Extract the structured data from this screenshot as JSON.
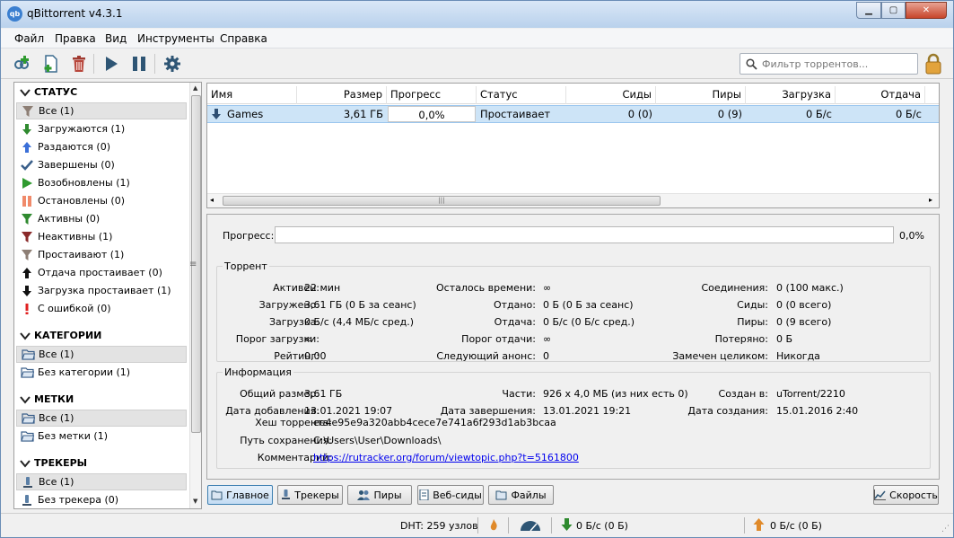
{
  "window": {
    "app_icon_text": "qb",
    "title": "qBittorrent v4.3.1",
    "min_symbol": "▁",
    "max_symbol": "▢",
    "close_symbol": "✕"
  },
  "menu": [
    "Файл",
    "Правка",
    "Вид",
    "Инструменты",
    "Справка"
  ],
  "toolbar": {
    "search_placeholder": "Фильтр торрентов..."
  },
  "sidebar": {
    "status": {
      "title": "СТАТУС",
      "items": [
        {
          "label": "Все (1)",
          "icon": "funnel-icon",
          "color": "#8d7e74"
        },
        {
          "label": "Загружаются (1)",
          "icon": "arrow-down-icon",
          "color": "#2f8a2f"
        },
        {
          "label": "Раздаются (0)",
          "icon": "arrow-up-icon",
          "color": "#3a6fd8"
        },
        {
          "label": "Завершены (0)",
          "icon": "check-icon",
          "color": "#3a5f8a"
        },
        {
          "label": "Возобновлены (1)",
          "icon": "play-icon",
          "color": "#2f9a2f"
        },
        {
          "label": "Остановлены (0)",
          "icon": "pause-icon",
          "color": "#f08a6a"
        },
        {
          "label": "Активны (0)",
          "icon": "funnel-icon",
          "color": "#2f8a2f"
        },
        {
          "label": "Неактивны (1)",
          "icon": "funnel-icon",
          "color": "#8a2a2a"
        },
        {
          "label": "Простаивают (1)",
          "icon": "funnel-icon",
          "color": "#8d7e74"
        },
        {
          "label": "Отдача простаивает (0)",
          "icon": "arrow-up-icon",
          "color": "#111111"
        },
        {
          "label": "Загрузка простаивает (1)",
          "icon": "arrow-down-icon",
          "color": "#111111"
        },
        {
          "label": "С ошибкой (0)",
          "icon": "exclamation-icon",
          "color": "#e02020"
        }
      ]
    },
    "categories": {
      "title": "КАТЕГОРИИ",
      "items": [
        "Все (1)",
        "Без категории (1)"
      ]
    },
    "tags": {
      "title": "МЕТКИ",
      "items": [
        "Все (1)",
        "Без метки (1)"
      ]
    },
    "trackers": {
      "title": "ТРЕКЕРЫ",
      "items": [
        "Все (1)",
        "Без трекера (0)"
      ]
    }
  },
  "table": {
    "columns": [
      "Имя",
      "Размер",
      "Прогресс",
      "Статус",
      "Сиды",
      "Пиры",
      "Загрузка",
      "Отдача"
    ],
    "row": {
      "name": "Games",
      "size": "3,61 ГБ",
      "progress": "0,0%",
      "status": "Простаивает",
      "seeds": "0 (0)",
      "peers": "0 (9)",
      "down": "0 Б/с",
      "up": "0 Б/с"
    }
  },
  "details": {
    "progress_label": "Прогресс:",
    "progress_value": "0,0%",
    "torrent_group": "Торрент",
    "torrent": [
      [
        "Активен:",
        "22 мин",
        "Осталось времени:",
        "∞",
        "Соединения:",
        "0 (100 макс.)"
      ],
      [
        "Загружено:",
        "3,61 ГБ (0 Б за сеанс)",
        "Отдано:",
        "0 Б (0 Б за сеанс)",
        "Сиды:",
        "0 (0 всего)"
      ],
      [
        "Загрузка:",
        "0 Б/с (4,4 МБ/с сред.)",
        "Отдача:",
        "0 Б/с (0 Б/с сред.)",
        "Пиры:",
        "0 (9 всего)"
      ],
      [
        "Порог загрузки:",
        "∞",
        "Порог отдачи:",
        "∞",
        "Потеряно:",
        "0 Б"
      ],
      [
        "Рейтинг:",
        "0,00",
        "Следующий анонс:",
        "0",
        "Замечен целиком:",
        "Никогда"
      ]
    ],
    "info_group": "Информация",
    "info_top": [
      [
        "Общий размер:",
        "3,61 ГБ",
        "Части:",
        "926 x 4,0 МБ (из них есть 0)",
        "Создан в:",
        "uTorrent/2210"
      ],
      [
        "Дата добавления:",
        "13.01.2021 19:07",
        "Дата завершения:",
        "13.01.2021 19:21",
        "Дата создания:",
        "15.01.2016 2:40"
      ]
    ],
    "hash_label": "Хеш торрента:",
    "hash": "ee4e95e9a320abb4cece7e741a6f293d1ab3bcaa",
    "path_label": "Путь сохранения:",
    "path": "C:\\Users\\User\\Downloads\\",
    "comment_label": "Комментарий:",
    "comment": "https://rutracker.org/forum/viewtopic.php?t=5161800"
  },
  "tabs": [
    "Главное",
    "Трекеры",
    "Пиры",
    "Веб-сиды",
    "Файлы"
  ],
  "speed_button": "Скорость",
  "statusbar": {
    "dht": "DHT: 259 узлов",
    "down": "0 Б/с (0 Б)",
    "up": "0 Б/с (0 Б)"
  }
}
